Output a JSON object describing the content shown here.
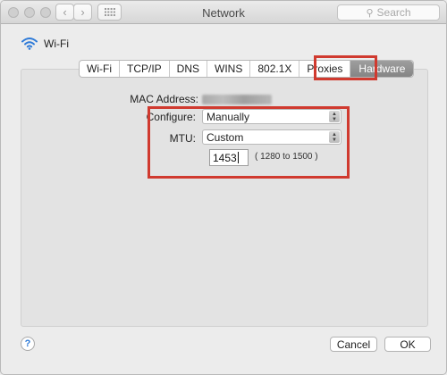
{
  "window": {
    "title": "Network"
  },
  "toolbar": {
    "back_icon": "chevron-left-icon",
    "forward_icon": "chevron-right-icon",
    "grid_icon": "grid-icon",
    "search_placeholder": "Search",
    "search_icon": "magnifier-icon"
  },
  "interface": {
    "name": "Wi-Fi",
    "icon": "wifi-icon",
    "icon_color": "#2f7bd8"
  },
  "tabs": [
    {
      "label": "Wi-Fi"
    },
    {
      "label": "TCP/IP"
    },
    {
      "label": "DNS"
    },
    {
      "label": "WINS"
    },
    {
      "label": "802.1X"
    },
    {
      "label": "Proxies"
    },
    {
      "label": "Hardware",
      "selected": true
    }
  ],
  "hardware": {
    "mac_address_label": "MAC Address:",
    "configure_label": "Configure:",
    "configure_value": "Manually",
    "mtu_label": "MTU:",
    "mtu_value": "Custom",
    "mtu_input_value": "1453",
    "mtu_range_hint": "( 1280 to 1500 )"
  },
  "buttons": {
    "help": "?",
    "cancel": "Cancel",
    "ok": "OK"
  },
  "annotation_color": "#d03a2f"
}
